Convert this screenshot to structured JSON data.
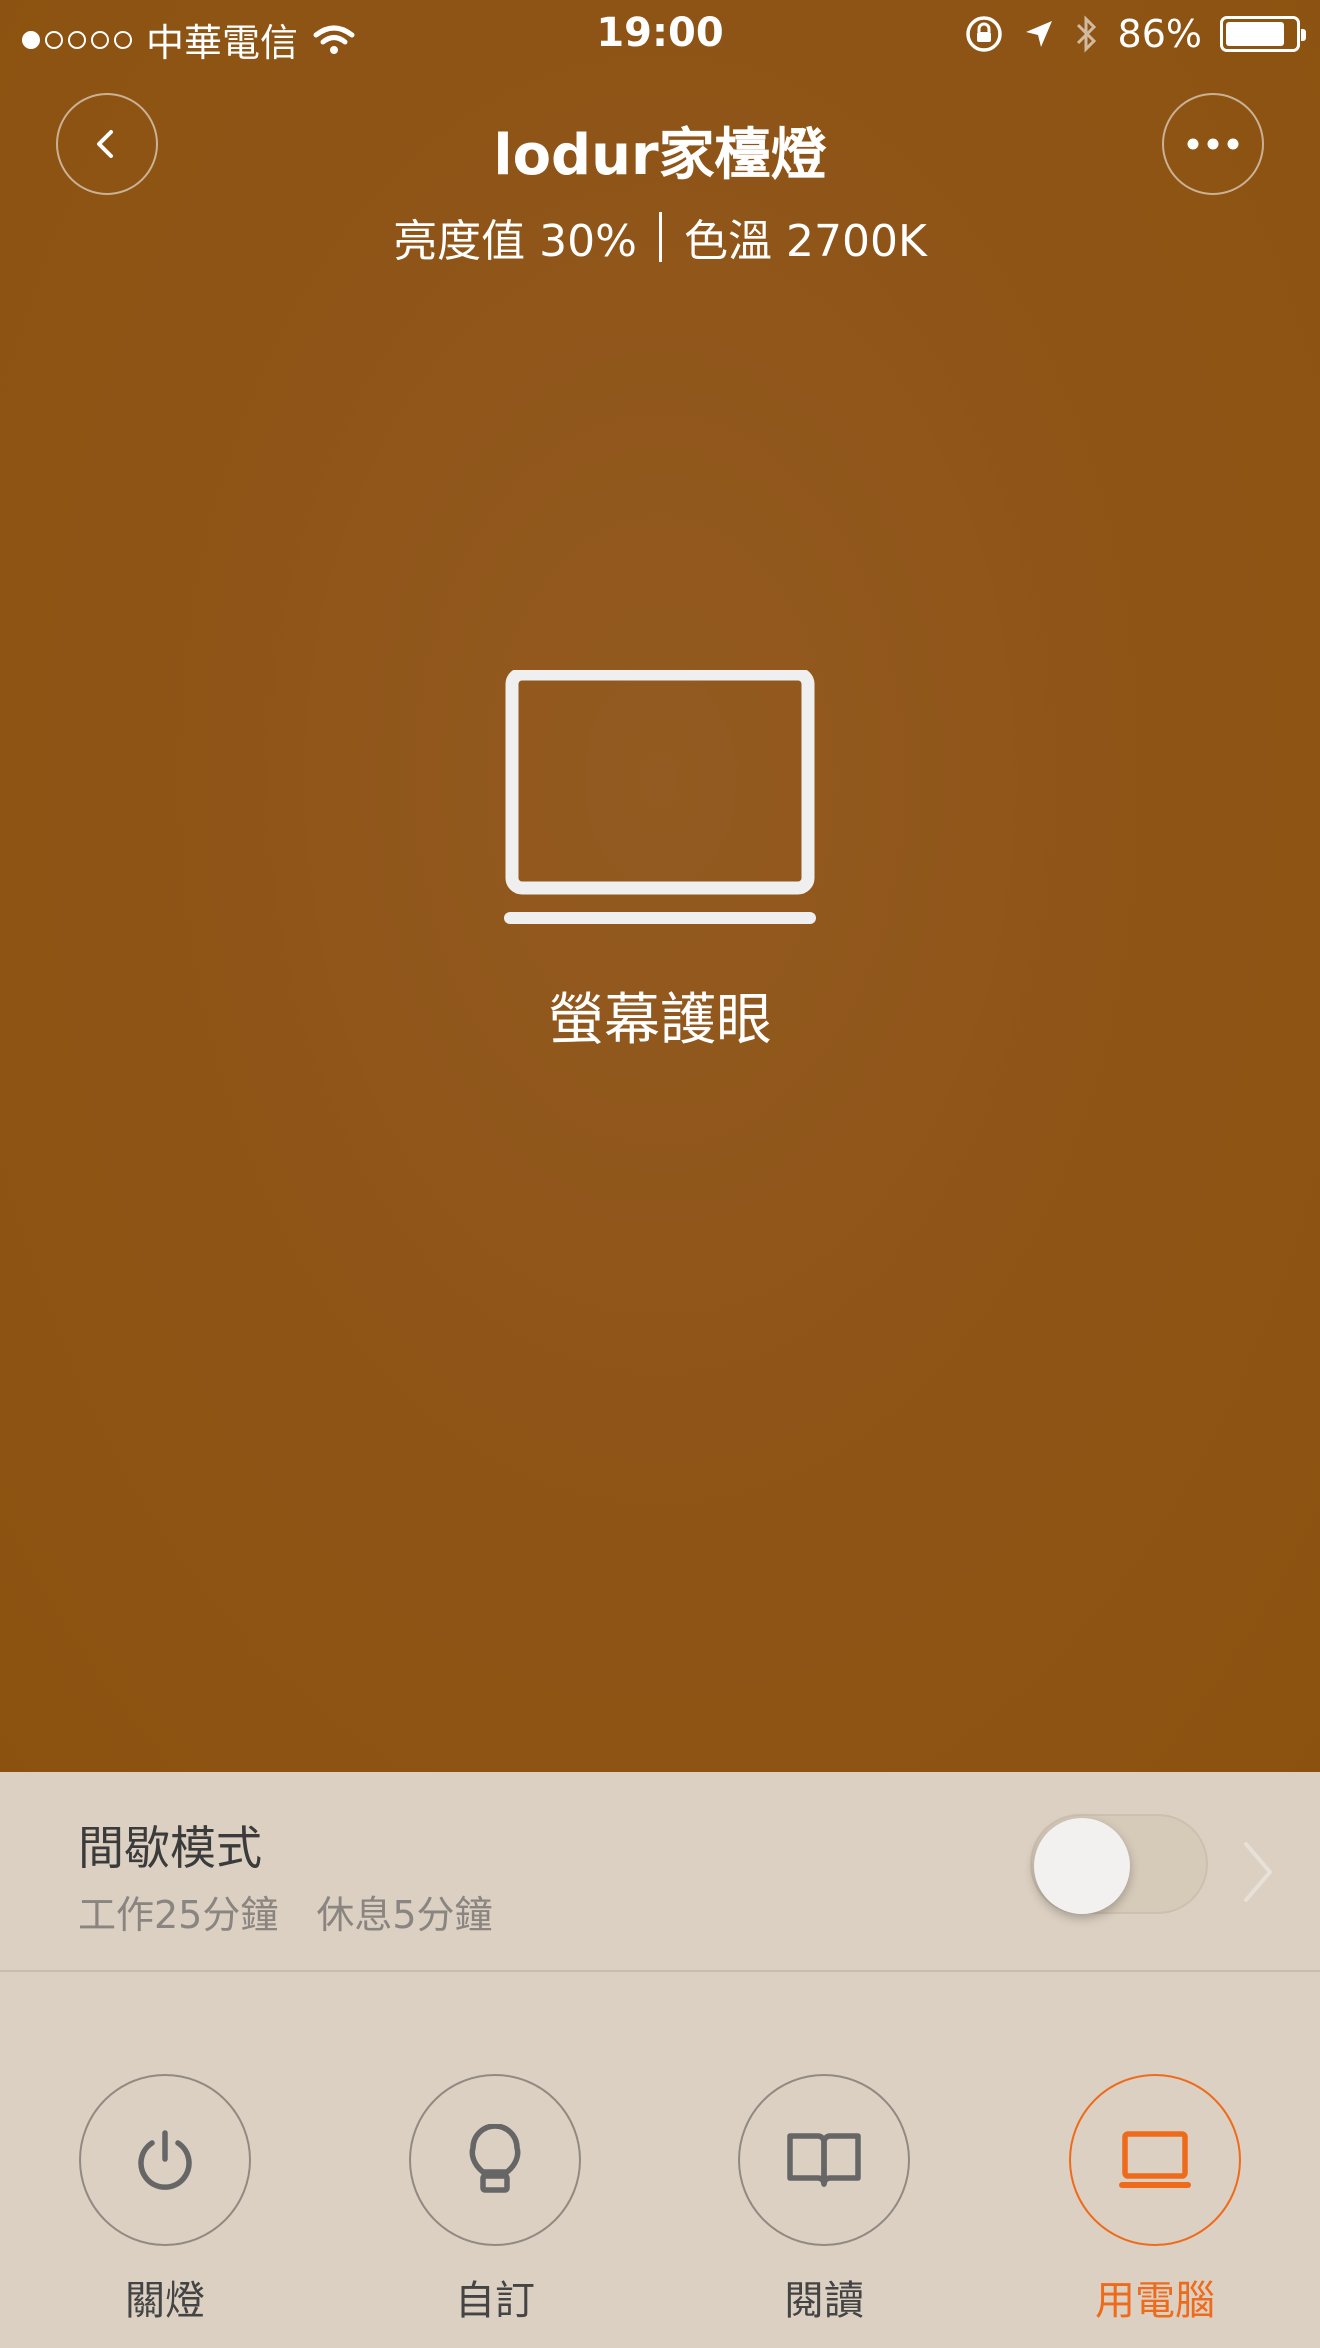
{
  "status_bar": {
    "carrier": "中華電信",
    "time": "19:00",
    "battery": "86%",
    "battery_level": 0.86
  },
  "header": {
    "title": "lodur家檯燈",
    "brightness": "亮度值 30%",
    "color_temp": "色溫 2700K"
  },
  "current_mode": {
    "icon": "laptop-icon",
    "label": "螢幕護眼"
  },
  "timer": {
    "title": "間歇模式",
    "subtitle": "工作25分鐘　休息5分鐘",
    "enabled": false
  },
  "modes": [
    {
      "label": "關燈",
      "icon": "power-icon",
      "active": false
    },
    {
      "label": "自訂",
      "icon": "bulb-icon",
      "active": false
    },
    {
      "label": "閱讀",
      "icon": "book-icon",
      "active": false
    },
    {
      "label": "用電腦",
      "icon": "laptop-icon",
      "active": true
    }
  ],
  "colors": {
    "hero_bg": "#8f5518",
    "panel_bg": "#dbd0c2",
    "accent": "#ef6b1c"
  }
}
